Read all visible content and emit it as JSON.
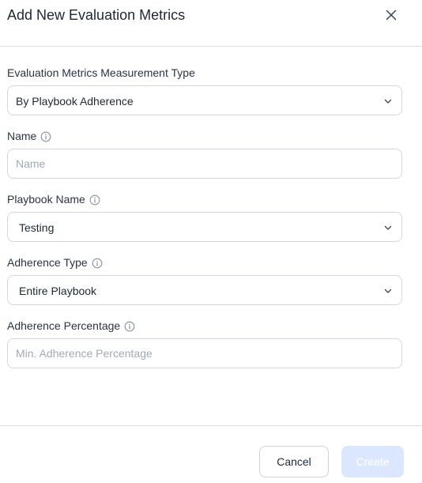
{
  "dialog": {
    "title": "Add New Evaluation Metrics"
  },
  "fields": {
    "measurement_type": {
      "label": "Evaluation Metrics Measurement Type",
      "value": "By Playbook Adherence"
    },
    "name": {
      "label": "Name",
      "value": "",
      "placeholder": "Name"
    },
    "playbook_name": {
      "label": "Playbook Name",
      "value": "Testing"
    },
    "adherence_type": {
      "label": "Adherence Type",
      "value": "Entire Playbook"
    },
    "adherence_percentage": {
      "label": "Adherence Percentage",
      "value": "",
      "placeholder": "Min. Adherence Percentage"
    }
  },
  "footer": {
    "cancel_label": "Cancel",
    "create_label": "Create"
  },
  "colors": {
    "create_button_disabled": "#dbe7ff",
    "border": "#d4d7dd",
    "text": "#1f2633",
    "placeholder": "#a3a8b1"
  },
  "icons": {
    "close": "close-icon",
    "info": "info-icon",
    "chevron": "chevron-down-icon"
  }
}
